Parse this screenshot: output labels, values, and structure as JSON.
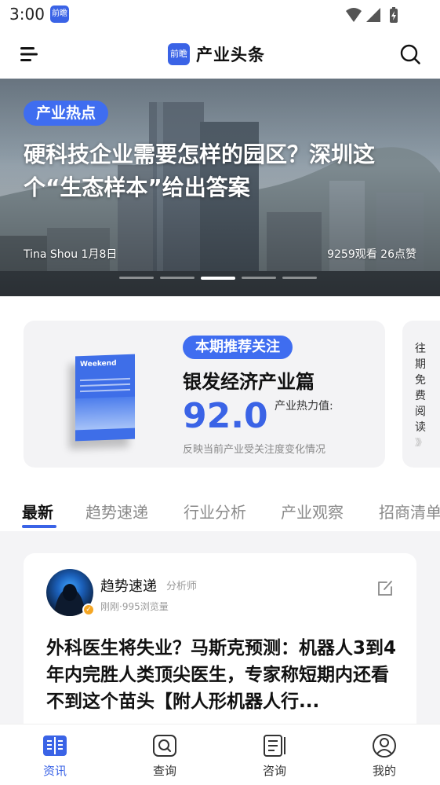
{
  "status_bar": {
    "time": "3:00",
    "app_icon_text": "前瞻"
  },
  "header": {
    "logo_text": "前瞻",
    "title": "产业头条"
  },
  "hero": {
    "tag": "产业热点",
    "title": "硬科技企业需要怎样的园区？深圳这个“生态样本”给出答案",
    "author_date": "Tina Shou 1月8日",
    "stats": "9259观看 26点赞",
    "dot_count": 5,
    "active_dot": 2
  },
  "recommend": {
    "badge": "本期推荐关注",
    "title": "银发经济产业篇",
    "heat_value": "92.0",
    "heat_label": "产业热力值:",
    "description": "反映当前产业受关注度变化情况",
    "magazine_title": "Weekend"
  },
  "past_issue": {
    "label": "往期免费阅读",
    "arrows": "》》"
  },
  "tabs": [
    {
      "label": "最新",
      "active": true
    },
    {
      "label": "趋势速递",
      "active": false
    },
    {
      "label": "行业分析",
      "active": false
    },
    {
      "label": "产业观察",
      "active": false
    },
    {
      "label": "招商清单",
      "active": false
    }
  ],
  "post": {
    "author": "趋势速递",
    "role": "分析师",
    "meta": "刚刚·995浏览量",
    "title": "外科医生将失业？马斯克预测：机器人3到4年内完胜人类顶尖医生，专家称短期内还看不到这个苗头【附人形机器人行..."
  },
  "bottom_nav": [
    {
      "label": "资讯",
      "icon": "news-icon",
      "active": true
    },
    {
      "label": "查询",
      "icon": "query-icon",
      "active": false
    },
    {
      "label": "咨询",
      "icon": "consult-icon",
      "active": false
    },
    {
      "label": "我的",
      "icon": "profile-icon",
      "active": false
    }
  ],
  "colors": {
    "accent": "#3a63e6",
    "tag_blue": "#3f6df0",
    "card_bg": "#f3f3f5"
  }
}
